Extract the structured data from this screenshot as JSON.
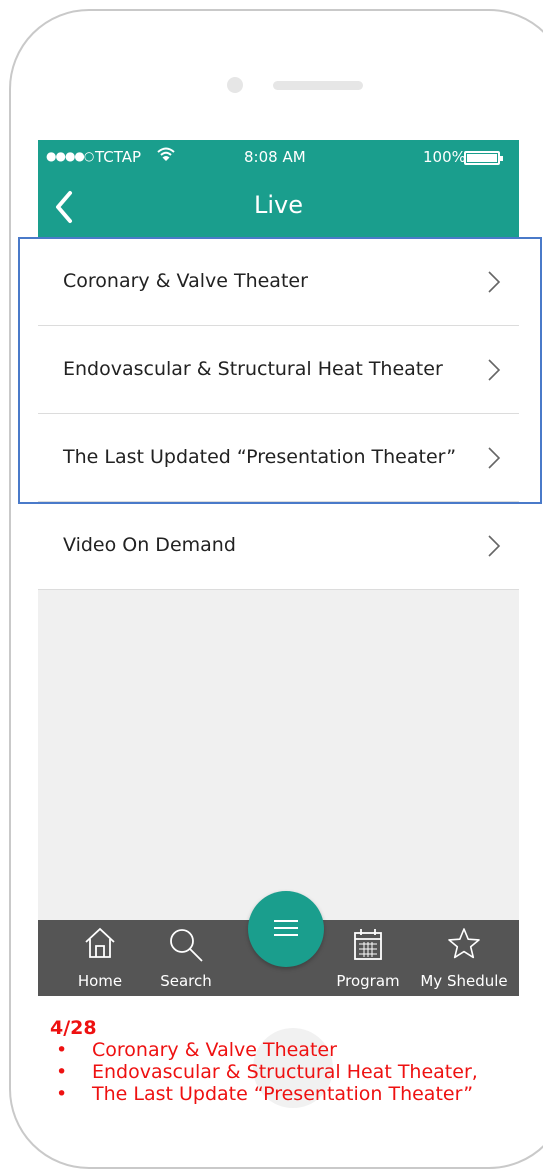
{
  "status_bar": {
    "signal": "●●●●○",
    "carrier": "TCTAP",
    "time": "8:08 AM",
    "battery": "100%"
  },
  "header": {
    "title": "Live"
  },
  "menu": {
    "items": [
      {
        "label": "Coronary & Valve Theater"
      },
      {
        "label": "Endovascular & Structural Heat Theater"
      },
      {
        "label": "The Last Updated “Presentation Theater”"
      },
      {
        "label": "Video On Demand"
      }
    ]
  },
  "tab_bar": {
    "items": [
      {
        "label": "Home",
        "icon": "home-icon"
      },
      {
        "label": "Search",
        "icon": "search-icon"
      },
      {
        "label": "Program",
        "icon": "calendar-icon"
      },
      {
        "label": "My Shedule",
        "icon": "star-icon"
      }
    ],
    "fab_icon": "menu-icon"
  },
  "notes": {
    "date": "4/28",
    "items": [
      "Coronary & Valve Theater",
      "Endovascular & Structural Heat Theater,",
      "The Last Update “Presentation Theater”"
    ]
  },
  "colors": {
    "accent": "#1a9e8d",
    "tab_bar": "#555555",
    "highlight": "#4a7ac9",
    "note_text": "#ee1111"
  }
}
